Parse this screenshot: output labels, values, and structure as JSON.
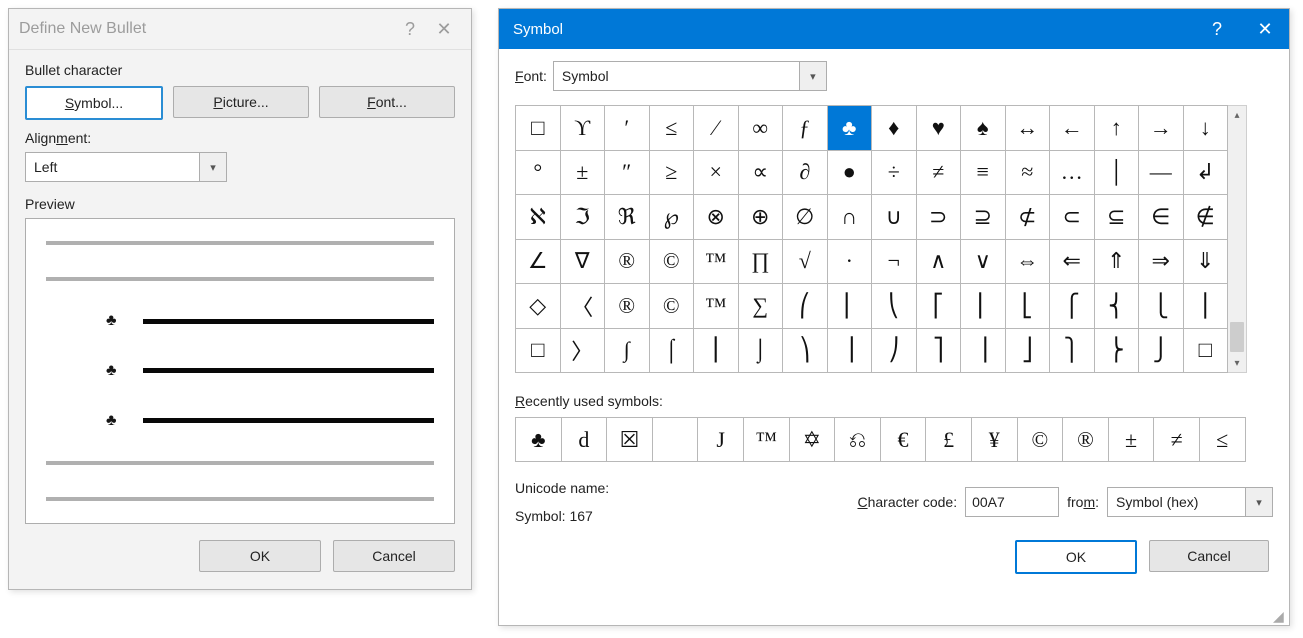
{
  "dnb": {
    "title": "Define New Bullet",
    "section_bullet_char": "Bullet character",
    "btn_symbol": "Symbol...",
    "btn_picture": "Picture...",
    "btn_font": "Font...",
    "align_label": "Alignment:",
    "align_value": "Left",
    "preview_label": "Preview",
    "ok": "OK",
    "cancel": "Cancel"
  },
  "sym": {
    "title": "Symbol",
    "font_label": "Font:",
    "font_value": "Symbol",
    "grid_selected_index": 7,
    "grid": [
      "□",
      "ϒ",
      "′",
      "≤",
      "⁄",
      "∞",
      "ƒ",
      "♣",
      "♦",
      "♥",
      "♠",
      "↔",
      "←",
      "↑",
      "→",
      "↓",
      "°",
      "±",
      "″",
      "≥",
      "×",
      "∝",
      "∂",
      "●",
      "÷",
      "≠",
      "≡",
      "≈",
      "…",
      "│",
      "—",
      "↲",
      "ℵ",
      "ℑ",
      "ℜ",
      "℘",
      "⊗",
      "⊕",
      "∅",
      "∩",
      "∪",
      "⊃",
      "⊇",
      "⊄",
      "⊂",
      "⊆",
      "∈",
      "∉",
      "∠",
      "∇",
      "®",
      "©",
      "™",
      "∏",
      "√",
      "·",
      "¬",
      "∧",
      "∨",
      "⇔",
      "⇐",
      "⇑",
      "⇒",
      "⇓",
      "◇",
      "〈",
      "®",
      "©",
      "™",
      "∑",
      "⎛",
      "⎜",
      "⎝",
      "⎡",
      "⎢",
      "⎣",
      "⎧",
      "⎨",
      "⎩",
      "⎪",
      "□",
      "〉",
      "∫",
      "⌠",
      "⎮",
      "⌡",
      "⎞",
      "⎟",
      "⎠",
      "⎤",
      "⎥",
      "⎦",
      "⎫",
      "⎬",
      "⎭",
      "□"
    ],
    "recent_label": "Recently used symbols:",
    "recent": [
      "♣",
      "d",
      "☒",
      " ",
      "J",
      "™",
      "✡",
      "⎌",
      "€",
      "£",
      "¥",
      "©",
      "®",
      "±",
      "≠",
      "≤"
    ],
    "unicode_name_label": "Unicode name:",
    "symbol_line": "Symbol: 167",
    "charcode_label": "Character code:",
    "charcode_value": "00A7",
    "from_label": "from:",
    "from_value": "Symbol (hex)",
    "ok": "OK",
    "cancel": "Cancel"
  },
  "chart_data": null
}
